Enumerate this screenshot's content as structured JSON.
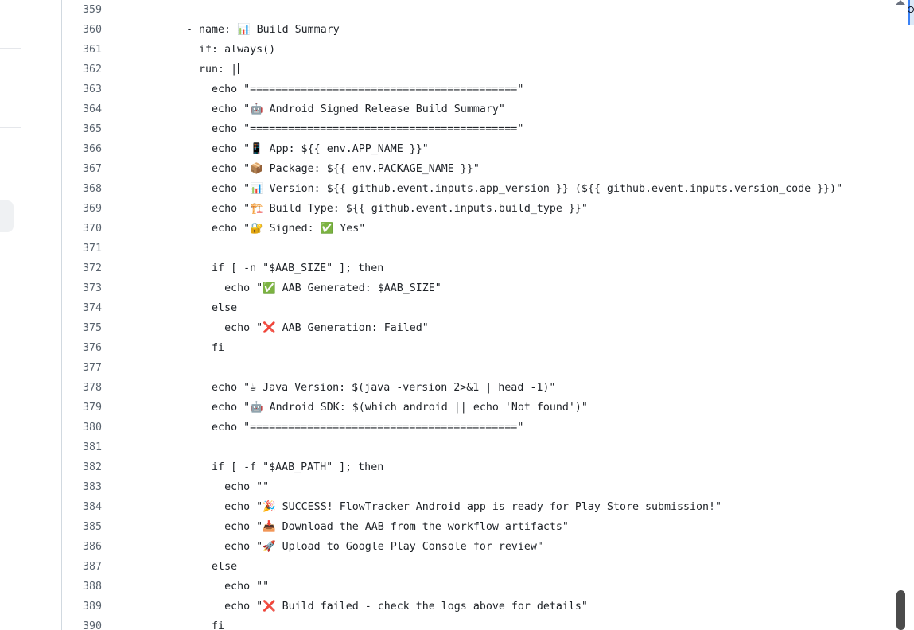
{
  "code": {
    "lines": [
      {
        "number": "359",
        "text": ""
      },
      {
        "number": "360",
        "text": "      - name: 📊 Build Summary"
      },
      {
        "number": "361",
        "text": "        if: always()"
      },
      {
        "number": "362",
        "text": "        run: |"
      },
      {
        "number": "363",
        "text": "          echo \"==========================================\""
      },
      {
        "number": "364",
        "text": "          echo \"🤖 Android Signed Release Build Summary\""
      },
      {
        "number": "365",
        "text": "          echo \"==========================================\""
      },
      {
        "number": "366",
        "text": "          echo \"📱 App: ${{ env.APP_NAME }}\""
      },
      {
        "number": "367",
        "text": "          echo \"📦 Package: ${{ env.PACKAGE_NAME }}\""
      },
      {
        "number": "368",
        "text": "          echo \"📊 Version: ${{ github.event.inputs.app_version }} (${{ github.event.inputs.version_code }})\""
      },
      {
        "number": "369",
        "text": "          echo \"🏗️ Build Type: ${{ github.event.inputs.build_type }}\""
      },
      {
        "number": "370",
        "text": "          echo \"🔐 Signed: ✅ Yes\""
      },
      {
        "number": "371",
        "text": ""
      },
      {
        "number": "372",
        "text": "          if [ -n \"$AAB_SIZE\" ]; then"
      },
      {
        "number": "373",
        "text": "            echo \"✅ AAB Generated: $AAB_SIZE\""
      },
      {
        "number": "374",
        "text": "          else"
      },
      {
        "number": "375",
        "text": "            echo \"❌ AAB Generation: Failed\""
      },
      {
        "number": "376",
        "text": "          fi"
      },
      {
        "number": "377",
        "text": ""
      },
      {
        "number": "378",
        "text": "          echo \"☕ Java Version: $(java -version 2>&1 | head -1)\""
      },
      {
        "number": "379",
        "text": "          echo \"🤖 Android SDK: $(which android || echo 'Not found')\""
      },
      {
        "number": "380",
        "text": "          echo \"==========================================\""
      },
      {
        "number": "381",
        "text": ""
      },
      {
        "number": "382",
        "text": "          if [ -f \"$AAB_PATH\" ]; then"
      },
      {
        "number": "383",
        "text": "            echo \"\""
      },
      {
        "number": "384",
        "text": "            echo \"🎉 SUCCESS! FlowTracker Android app is ready for Play Store submission!\""
      },
      {
        "number": "385",
        "text": "            echo \"📥 Download the AAB from the workflow artifacts\""
      },
      {
        "number": "386",
        "text": "            echo \"🚀 Upload to Google Play Console for review\""
      },
      {
        "number": "387",
        "text": "          else"
      },
      {
        "number": "388",
        "text": "            echo \"\""
      },
      {
        "number": "389",
        "text": "            echo \"❌ Build failed - check the logs above for details\""
      },
      {
        "number": "390",
        "text": "          fi"
      }
    ]
  },
  "edge": {
    "peek_text": "e"
  },
  "colors": {
    "code_text": "#1f2328",
    "line_number": "#59636e",
    "panel_border": "#d1d9e0",
    "scrollbar_thumb": "#4b4b4b"
  }
}
